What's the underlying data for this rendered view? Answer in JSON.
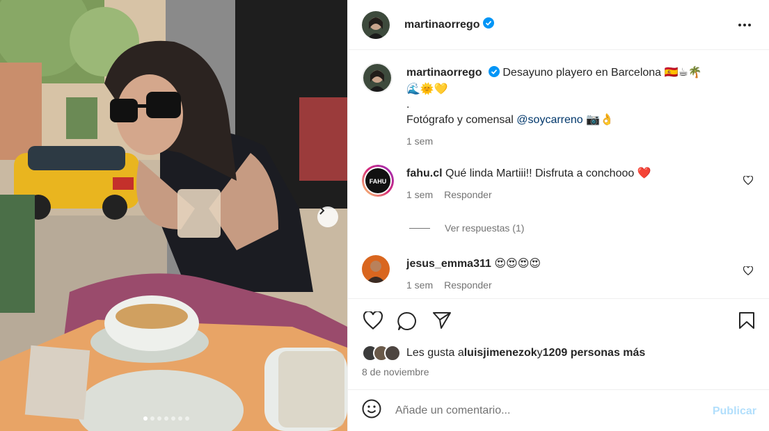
{
  "post": {
    "username": "martinaorrego",
    "more_label": "More options",
    "carousel": {
      "slide_count": 7,
      "active_slide": 1
    }
  },
  "caption": {
    "username": "martinaorrego",
    "line1": "Desayuno playero en Barcelona 🇪🇸☕🌴",
    "line2": "🌊🌞💛",
    "line3": ".",
    "line4_prefix": "Fotógrafo y comensal ",
    "mention": "@soycarreno",
    "line4_suffix": " 📷👌",
    "time": "1 sem"
  },
  "comments": [
    {
      "username": "fahu.cl",
      "text": "Qué linda Martiii!! Disfruta a conchooo ❤️",
      "time": "1 sem",
      "reply": "Responder",
      "avatar_text": "FAHU"
    },
    {
      "username": "jesus_emma311",
      "text": "😍😍😍😍",
      "time": "1 sem",
      "reply": "Responder"
    }
  ],
  "view_replies": "Ver respuestas (1)",
  "likes": {
    "prefix": "Les gusta a ",
    "user": "luisjimenezok",
    "middle": " y ",
    "count_text": "1209 personas más"
  },
  "date": "8 de noviembre",
  "add_comment": {
    "placeholder": "Añade un comentario...",
    "publish": "Publicar"
  },
  "icons": {
    "heart": "heart-icon",
    "comment": "comment-icon",
    "share": "share-icon",
    "save": "bookmark-icon",
    "emoji": "emoji-icon",
    "verified": "verified-badge-icon",
    "next": "chevron-right-icon"
  },
  "colors": {
    "verified": "#0095f6",
    "link": "#00376b",
    "muted": "#737373",
    "publish_disabled": "#b2dffc",
    "heart_red": "#ed4956"
  }
}
